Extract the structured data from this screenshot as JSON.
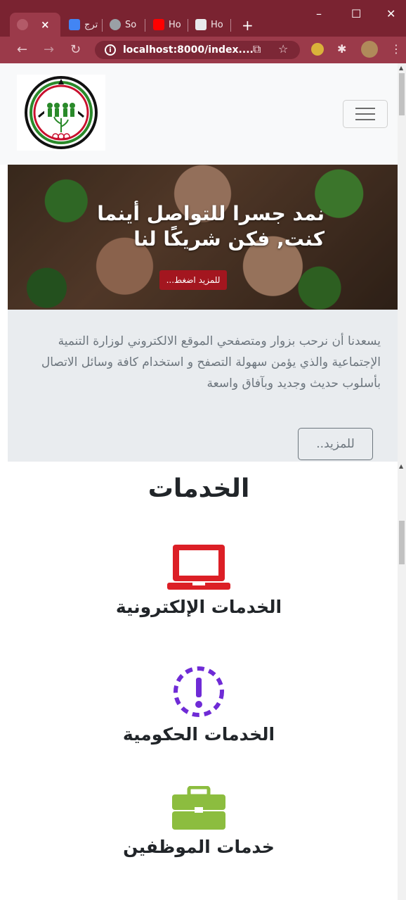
{
  "browser": {
    "tabs": [
      {
        "label": "",
        "active": true
      },
      {
        "label": "ترج",
        "favicon_color": "#4285f4"
      },
      {
        "label": "So",
        "favicon_color": "#9aa0a6"
      },
      {
        "label": "Ho",
        "favicon_color": "#ff0000"
      },
      {
        "label": "Ho",
        "favicon_color": "#e8eaed"
      }
    ],
    "close_glyph": "×",
    "new_tab_glyph": "+",
    "window_controls": {
      "minimize": "–",
      "maximize": "☐",
      "close": "✕"
    },
    "nav": {
      "back": "←",
      "forward": "→",
      "reload": "↻"
    },
    "url": "localhost:8000/index....",
    "translate_icon": "⧉",
    "star_icon": "☆",
    "menu_icon": "⋮",
    "extension_icon": "✱"
  },
  "site": {
    "logo_alt": "",
    "hero": {
      "title": "نمد جسرا للتواصل أينما كنت, فكن شريكًا لنا",
      "button": "للمزيد اضغط..."
    },
    "welcome": {
      "text": "يسعدنا أن نرحب بزوار ومتصفحي الموقع الالكتروني لوزارة التنمية الإجتماعية والذي يؤمن سهولة التصفح و استخدام كافة وسائل الاتصال بأسلوب حديث وجديد وبآفاق واسعة",
      "more_button": "للمزيد.."
    },
    "services": {
      "title": "الخدمات",
      "items": [
        {
          "label": "الخدمات الإلكترونية",
          "icon": "laptop-icon",
          "color": "#dc1f26"
        },
        {
          "label": "الخدمات الحكومية",
          "icon": "exclamation-circle-icon",
          "color": "#6f2bd6"
        },
        {
          "label": "خدمات الموظفين",
          "icon": "briefcase-icon",
          "color": "#8cbd3f"
        }
      ]
    }
  }
}
